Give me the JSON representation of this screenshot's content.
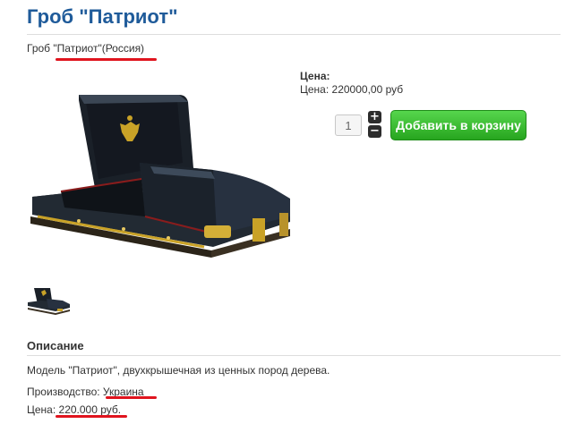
{
  "product": {
    "title": "Гроб \"Патриот\"",
    "subtitle": "Гроб \"Патриот\"(Россия)"
  },
  "price": {
    "heading": "Цена:",
    "line": "Цена: 220000,00 руб"
  },
  "cart": {
    "quantity": "1",
    "plus": "+",
    "minus": "−",
    "add_label": "Добавить в корзину"
  },
  "description": {
    "heading": "Описание",
    "text": "Модель \"Патриот\", двухкрышечная из ценных пород дерева.",
    "production": "Производство: Украина",
    "price": "Цена: 220.000 руб."
  },
  "colors": {
    "title": "#1f5b9a",
    "button": "#27a51f",
    "highlight": "#e0141e"
  },
  "icons": [
    "coffin-product-image",
    "coffin-thumbnail",
    "plus-icon",
    "minus-icon"
  ]
}
